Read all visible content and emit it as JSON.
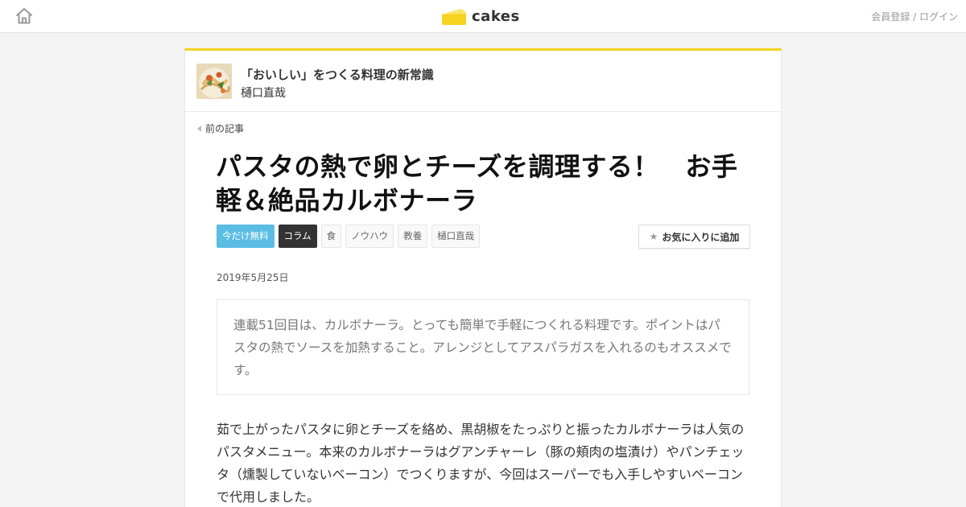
{
  "header": {
    "logo_text": "cakes",
    "auth_register": "会員登録",
    "auth_sep": "/",
    "auth_login": "ログイン",
    "brand_color": "#f6d320"
  },
  "series": {
    "title": "「おいしい」をつくる料理の新常識",
    "author": "樋口直哉"
  },
  "nav": {
    "prev_label": "前の記事"
  },
  "article": {
    "title": "パスタの熱で卵とチーズを調理する！　お手軽＆絶品カルボナーラ",
    "tags": [
      {
        "label": "今だけ無料",
        "style": "free"
      },
      {
        "label": "コラム",
        "style": "column"
      },
      {
        "label": "食",
        "style": "plain"
      },
      {
        "label": "ノウハウ",
        "style": "plain"
      },
      {
        "label": "教養",
        "style": "plain"
      },
      {
        "label": "樋口直哉",
        "style": "plain"
      }
    ],
    "favorite_label": "お気に入りに追加",
    "date": "2019年5月25日",
    "lead": "連載51回目は、カルボナーラ。とっても簡単で手軽につくれる料理です。ポイントはパスタの熱でソースを加熱すること。アレンジとしてアスパラガスを入れるのもオススメです。",
    "body": "茹で上がったパスタに卵とチーズを絡め、黒胡椒をたっぷりと振ったカルボナーラは人気のパスタメニュー。本来のカルボナーラはグアンチャーレ（豚の頬肉の塩漬け）やパンチェッタ（燻製していないベーコン）でつくりますが、今回はスーパーでも入手しやすいベーコンで代用しました。"
  },
  "icons": {
    "home": "home-icon",
    "logo": "cake-logo-icon",
    "prev": "chevron-left-icon",
    "star": "star-icon"
  }
}
